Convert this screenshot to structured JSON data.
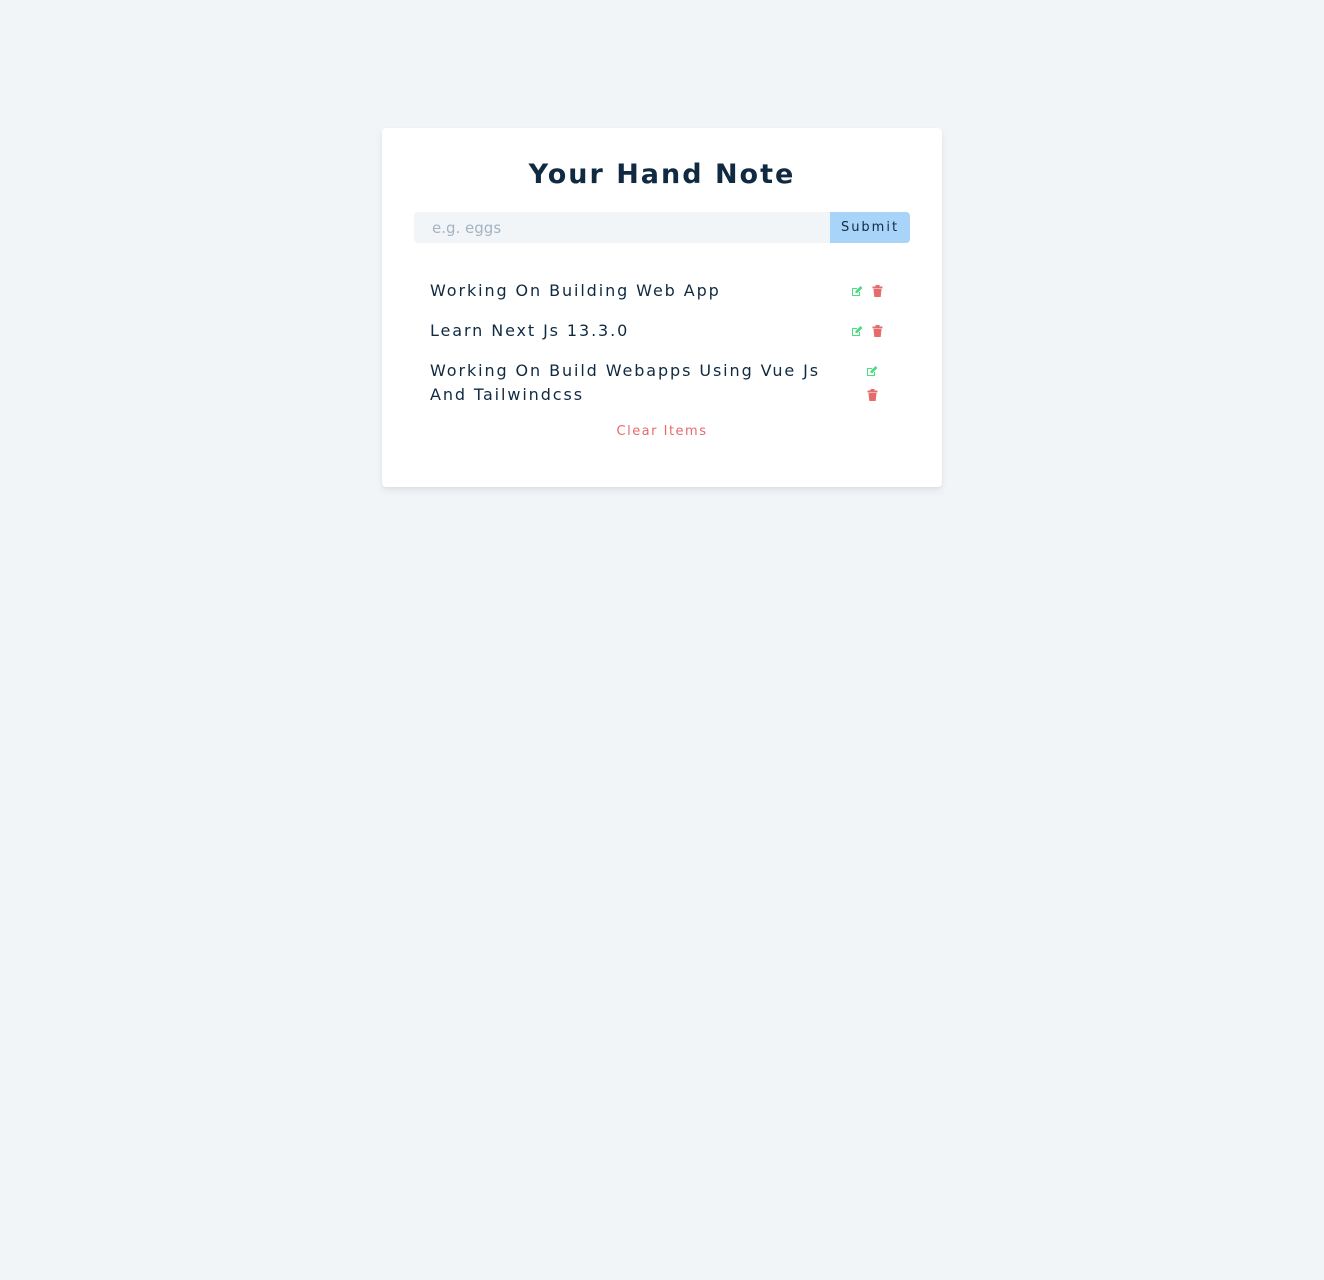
{
  "title": "Your Hand Note",
  "form": {
    "placeholder": "e.g. eggs",
    "value": "",
    "submit_label": "Submit"
  },
  "items": [
    {
      "text": "Working On Building Web App"
    },
    {
      "text": "Learn Next Js 13.3.0"
    },
    {
      "text": "Working On Build Webapps Using Vue Js And Tailwindcss"
    }
  ],
  "icons": {
    "edit": "edit-icon",
    "delete": "trash-icon"
  },
  "colors": {
    "edit": "#4ade80",
    "delete": "#e66b6b",
    "submit_bg": "#a7d4f8",
    "title": "#102a42"
  },
  "clear_label": "Clear Items"
}
